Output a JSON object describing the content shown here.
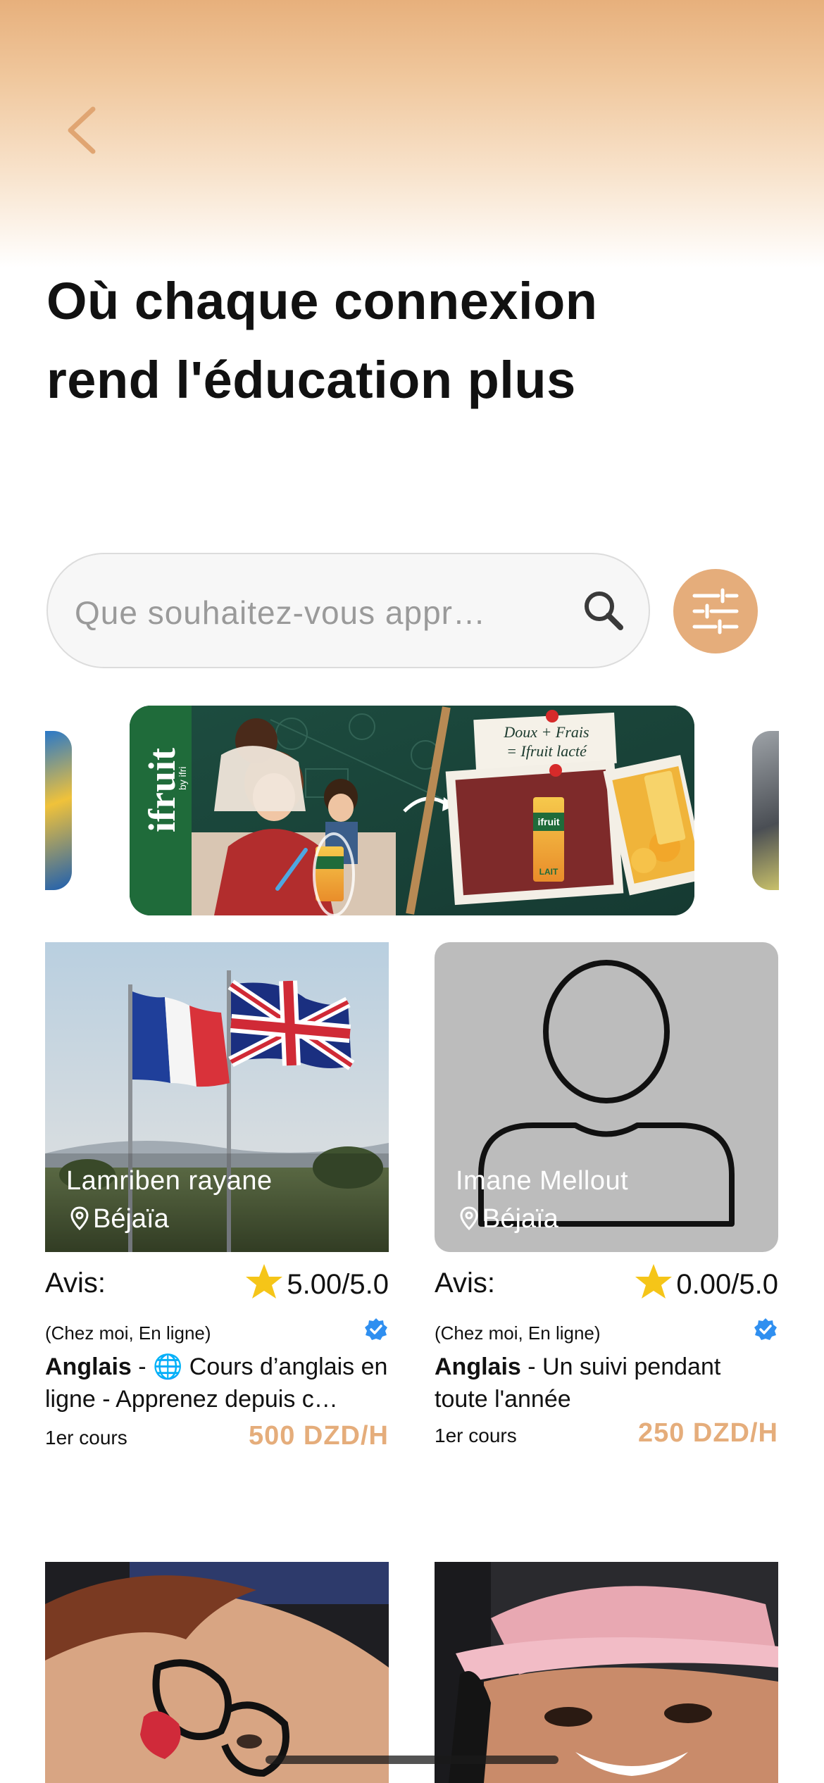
{
  "header": {
    "back_icon": "chevron-left-icon",
    "headline_line1": "Où chaque connexion",
    "headline_line2": "rend l'éducation plus"
  },
  "search": {
    "placeholder": "Que souhaitez-vous appr…",
    "value": "",
    "icon": "search-icon",
    "filter_icon": "sliders-icon"
  },
  "carousel": {
    "slides": [
      {
        "id": "left-partial"
      },
      {
        "id": "ifruit-banner",
        "brand": "ifruit",
        "brand_sub": "by ifri",
        "tagline_1": "Doux + Frais",
        "tagline_2": "= Ifruit lacté",
        "pack_label": "ifruit",
        "pack_sub": "LAIT"
      },
      {
        "id": "right-partial"
      }
    ]
  },
  "tutors": [
    {
      "name": "Lamriben rayane",
      "location": "Béjaïa",
      "avis_label": "Avis:",
      "rating": "5.00/5.0",
      "modes": "(Chez moi, En ligne)",
      "verified": true,
      "subject": "Anglais",
      "description": " - 🌐 Cours d’anglais en ligne - Apprenez depuis c…",
      "first_label": "1er cours",
      "price": "500 DZD/H",
      "photo": "flags-photo"
    },
    {
      "name": "Imane Mellout",
      "location": "Béjaïa",
      "avis_label": "Avis:",
      "rating": "0.00/5.0",
      "modes": "(Chez moi, En ligne)",
      "verified": true,
      "subject": "Anglais",
      "description": " - Un suivi pendant toute l'année",
      "first_label": "1er cours",
      "price": "250 DZD/H",
      "photo": "default-avatar"
    },
    {
      "photo": "selfie-photo-glasses"
    },
    {
      "photo": "selfie-photo-cap"
    }
  ],
  "colors": {
    "accent": "#e5ad7b",
    "verified": "#2f8ff0",
    "star": "#f5c518"
  }
}
